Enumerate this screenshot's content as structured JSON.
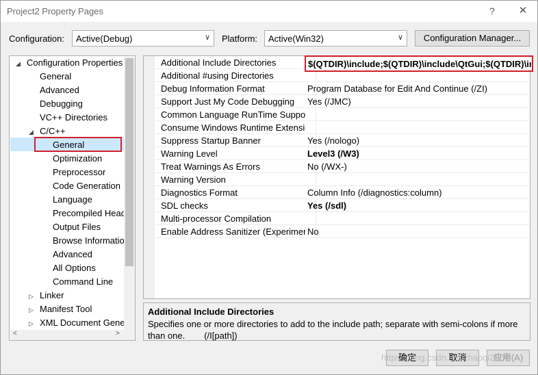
{
  "window": {
    "title": "Project2 Property Pages",
    "help_glyph": "?",
    "close_glyph": "✕"
  },
  "toolbar": {
    "configuration_label": "Configuration:",
    "configuration_value": "Active(Debug)",
    "platform_label": "Platform:",
    "platform_value": "Active(Win32)",
    "config_manager_button": "Configuration Manager..."
  },
  "tree": {
    "items": [
      {
        "label": "Configuration Properties",
        "expander": "◢"
      },
      {
        "label": "General"
      },
      {
        "label": "Advanced"
      },
      {
        "label": "Debugging"
      },
      {
        "label": "VC++ Directories"
      },
      {
        "label": "C/C++",
        "expander": "◢"
      },
      {
        "label": "General",
        "selected": true
      },
      {
        "label": "Optimization"
      },
      {
        "label": "Preprocessor"
      },
      {
        "label": "Code Generation"
      },
      {
        "label": "Language"
      },
      {
        "label": "Precompiled Head"
      },
      {
        "label": "Output Files"
      },
      {
        "label": "Browse Informatio"
      },
      {
        "label": "Advanced"
      },
      {
        "label": "All Options"
      },
      {
        "label": "Command Line"
      },
      {
        "label": "Linker",
        "expander": "▷"
      },
      {
        "label": "Manifest Tool",
        "expander": "▷"
      },
      {
        "label": "XML Document Gene",
        "expander": "▷"
      }
    ],
    "scroll_left": "<",
    "scroll_right": ">"
  },
  "properties": [
    {
      "name": "Additional Include Directories",
      "value": "$(QTDIR)\\include;$(QTDIR)\\include\\QtGui;$(QTDIR)\\include\\QtCore",
      "bold": true
    },
    {
      "name": "Additional #using Directories",
      "value": ""
    },
    {
      "name": "Debug Information Format",
      "value": "Program Database for Edit And Continue (/ZI)"
    },
    {
      "name": "Support Just My Code Debugging",
      "value": "Yes (/JMC)"
    },
    {
      "name": "Common Language RunTime Support",
      "value": ""
    },
    {
      "name": "Consume Windows Runtime Extension",
      "value": ""
    },
    {
      "name": "Suppress Startup Banner",
      "value": "Yes (/nologo)"
    },
    {
      "name": "Warning Level",
      "value": "Level3 (/W3)",
      "bold": true
    },
    {
      "name": "Treat Warnings As Errors",
      "value": "No (/WX-)"
    },
    {
      "name": "Warning Version",
      "value": ""
    },
    {
      "name": "Diagnostics Format",
      "value": "Column Info (/diagnostics:column)"
    },
    {
      "name": "SDL checks",
      "value": "Yes (/sdl)",
      "bold": true
    },
    {
      "name": "Multi-processor Compilation",
      "value": ""
    },
    {
      "name": "Enable Address Sanitizer (Experimental)",
      "value": "No"
    }
  ],
  "description": {
    "title": "Additional Include Directories",
    "text": "Specifies one or more directories to add to the include path; separate with semi-colons if more than one.",
    "switch": "(/I[path])"
  },
  "buttons": {
    "ok": "确定",
    "cancel": "取消",
    "apply": "应用(A)"
  },
  "watermark": "https://blog.csdn.net/zhaoqi2000"
}
